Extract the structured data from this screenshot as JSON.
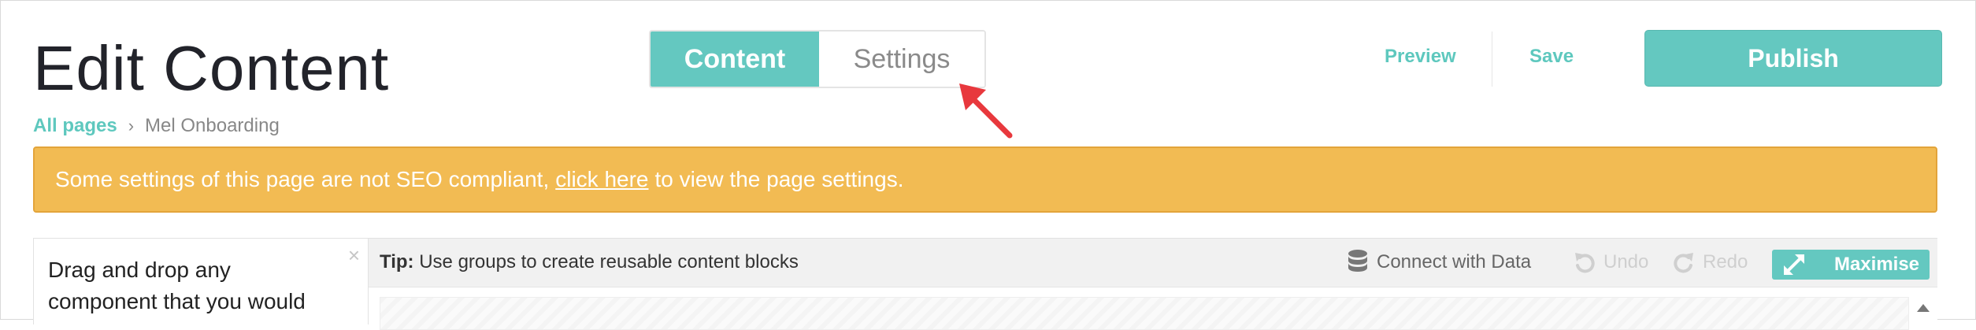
{
  "header": {
    "title": "Edit Content",
    "breadcrumb": {
      "root": "All pages",
      "separator": "›",
      "current": "Mel Onboarding"
    },
    "tabs": [
      {
        "label": "Content",
        "active": true
      },
      {
        "label": "Settings",
        "active": false
      }
    ],
    "actions": {
      "preview": "Preview",
      "save": "Save",
      "publish": "Publish"
    }
  },
  "banner": {
    "text_before": "Some settings of this page are not SEO compliant,",
    "link": "click here",
    "text_after": "to view the page settings."
  },
  "component_panel": {
    "text": "Drag and drop any component that you would",
    "close_glyph": "×"
  },
  "toolbar": {
    "tip_label": "Tip:",
    "tip_text": "Use groups to create reusable content blocks",
    "connect": "Connect with Data",
    "undo": "Undo",
    "redo": "Redo",
    "maximise": "Maximise"
  },
  "icons": {
    "database": "database-icon",
    "undo": "undo-icon",
    "redo": "redo-icon",
    "expand": "expand-icon",
    "arrow": "annotation-arrow",
    "scroll_up": "scroll-up-icon"
  },
  "colors": {
    "accent": "#64c8c0",
    "link": "#5ec8be",
    "warning_bg": "#f2bb53",
    "annotation_arrow": "#e8383d"
  }
}
